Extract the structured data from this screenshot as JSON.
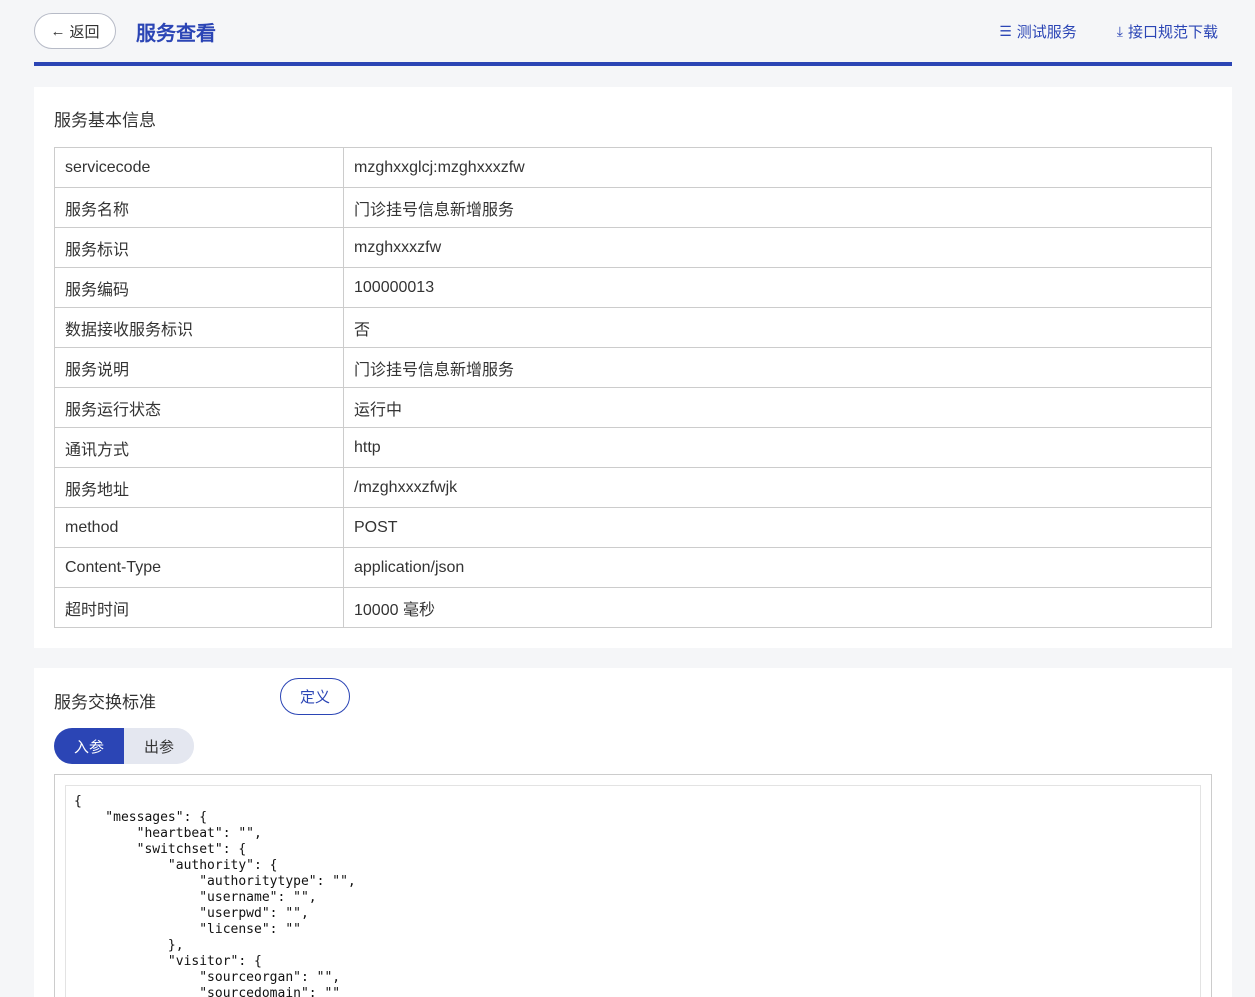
{
  "header": {
    "back_label": "返回",
    "title": "服务查看",
    "test_service_label": "测试服务",
    "download_spec_label": "接口规范下载"
  },
  "basic_info": {
    "title": "服务基本信息",
    "rows": [
      {
        "key": "servicecode",
        "value": "mzghxxglcj:mzghxxxzfw"
      },
      {
        "key": "服务名称",
        "value": "门诊挂号信息新增服务"
      },
      {
        "key": "服务标识",
        "value": "mzghxxxzfw"
      },
      {
        "key": "服务编码",
        "value": "100000013"
      },
      {
        "key": "数据接收服务标识",
        "value": "否"
      },
      {
        "key": "服务说明",
        "value": "门诊挂号信息新增服务"
      },
      {
        "key": "服务运行状态",
        "value": "运行中"
      },
      {
        "key": "通讯方式",
        "value": "http"
      },
      {
        "key": "服务地址",
        "value": "/mzghxxxzfwjk"
      },
      {
        "key": "method",
        "value": "POST"
      },
      {
        "key": "Content-Type",
        "value": "application/json"
      },
      {
        "key": "超时时间",
        "value": "10000 毫秒"
      }
    ]
  },
  "exchange": {
    "title": "服务交换标准",
    "define_label": "定义",
    "tabs": [
      {
        "label": "入参",
        "active": true
      },
      {
        "label": "出参",
        "active": false
      }
    ],
    "code": "{\n    \"messages\": {\n        \"heartbeat\": \"\",\n        \"switchset\": {\n            \"authority\": {\n                \"authoritytype\": \"\",\n                \"username\": \"\",\n                \"userpwd\": \"\",\n                \"license\": \"\"\n            },\n            \"visitor\": {\n                \"sourceorgan\": \"\",\n                \"sourcedomain\": \"\""
  },
  "colors": {
    "accent": "#2b45b5"
  }
}
